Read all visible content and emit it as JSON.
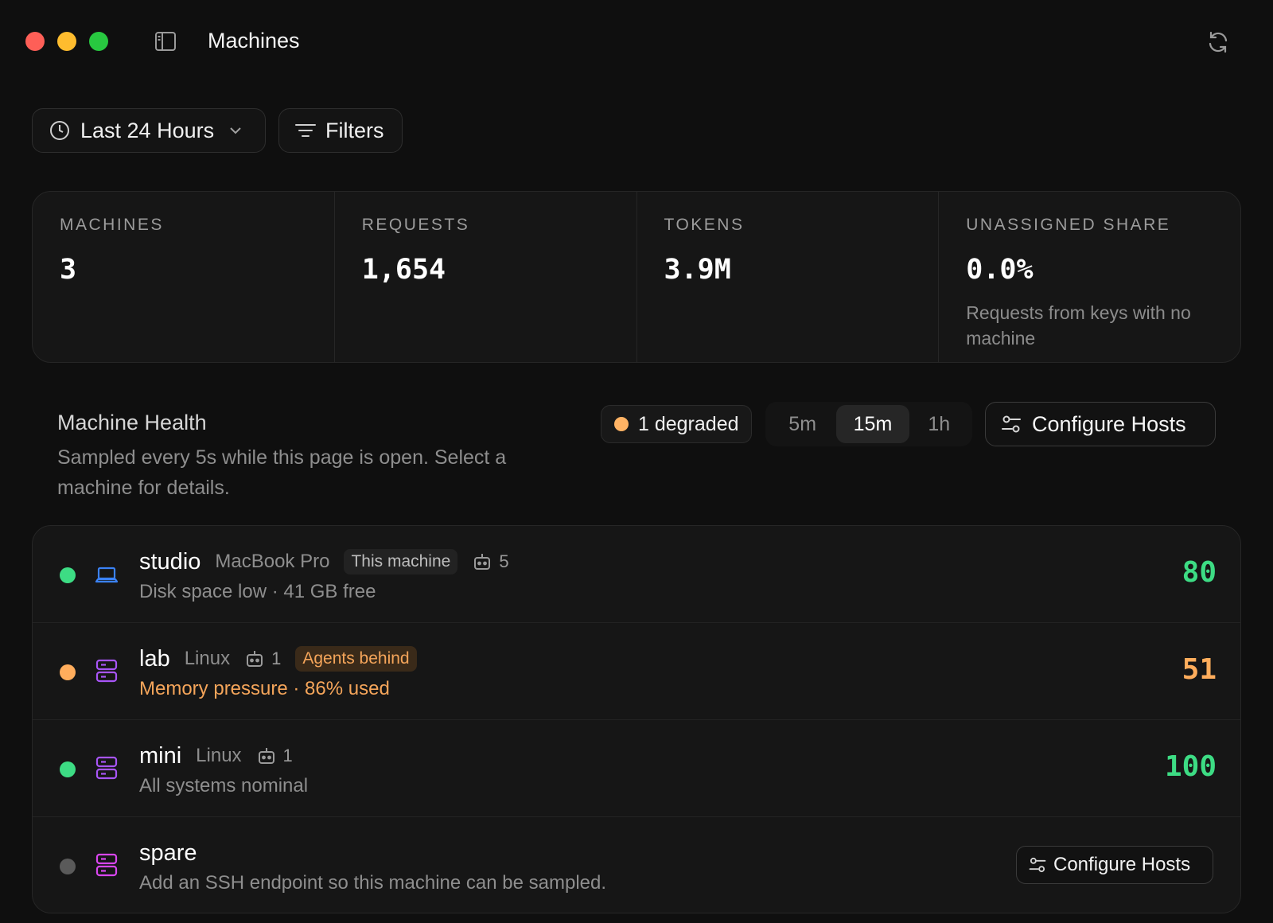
{
  "window": {
    "title": "Machines",
    "traffic_lights": [
      "close",
      "minimize",
      "zoom"
    ],
    "colors": {
      "close": "#fe5f57",
      "minimize": "#febc2e",
      "zoom": "#28c840"
    }
  },
  "toolbar": {
    "range_label": "Last 24 Hours",
    "filters_label": "Filters"
  },
  "stats": [
    {
      "label": "MACHINES",
      "value": "3",
      "sub": ""
    },
    {
      "label": "REQUESTS",
      "value": "1,654",
      "sub": ""
    },
    {
      "label": "TOKENS",
      "value": "3.9M",
      "sub": ""
    },
    {
      "label": "UNASSIGNED SHARE",
      "value": "0.0%",
      "sub": "Requests from keys with no machine"
    }
  ],
  "health": {
    "title": "Machine Health",
    "description": "Sampled every 5s while this page is open. Select a machine for details.",
    "degraded_label": "1 degraded",
    "intervals": [
      "5m",
      "15m",
      "1h"
    ],
    "selected_interval": "15m",
    "configure_label": "Configure Hosts"
  },
  "machines": [
    {
      "name": "studio",
      "model": "MacBook Pro",
      "badge": "This machine",
      "agents": "5",
      "status_line": "Disk space low · 41 GB free",
      "score": "80",
      "status": "healthy",
      "type_icon": "laptop-icon"
    },
    {
      "name": "lab",
      "model": "Linux",
      "agents": "1",
      "badge": "Agents behind",
      "status_line": "Memory pressure · 86% used",
      "score": "51",
      "status": "degraded",
      "type_icon": "server-icon"
    },
    {
      "name": "mini",
      "model": "Linux",
      "agents": "1",
      "status_line": "All systems nominal",
      "score": "100",
      "status": "healthy",
      "type_icon": "server-icon"
    },
    {
      "name": "spare",
      "status_line": "Add an SSH endpoint so this machine can be sampled.",
      "action_label": "Configure Hosts",
      "status": "unconfigured",
      "type_icon": "server-icon"
    }
  ],
  "colors": {
    "healthy": "#3ddc84",
    "degraded": "#ffad5c",
    "unconfigured": "#5a5a5a",
    "laptop_icon": "#3b82f6",
    "server_icon": "#a855f7",
    "server_icon_alt": "#d946ef"
  }
}
